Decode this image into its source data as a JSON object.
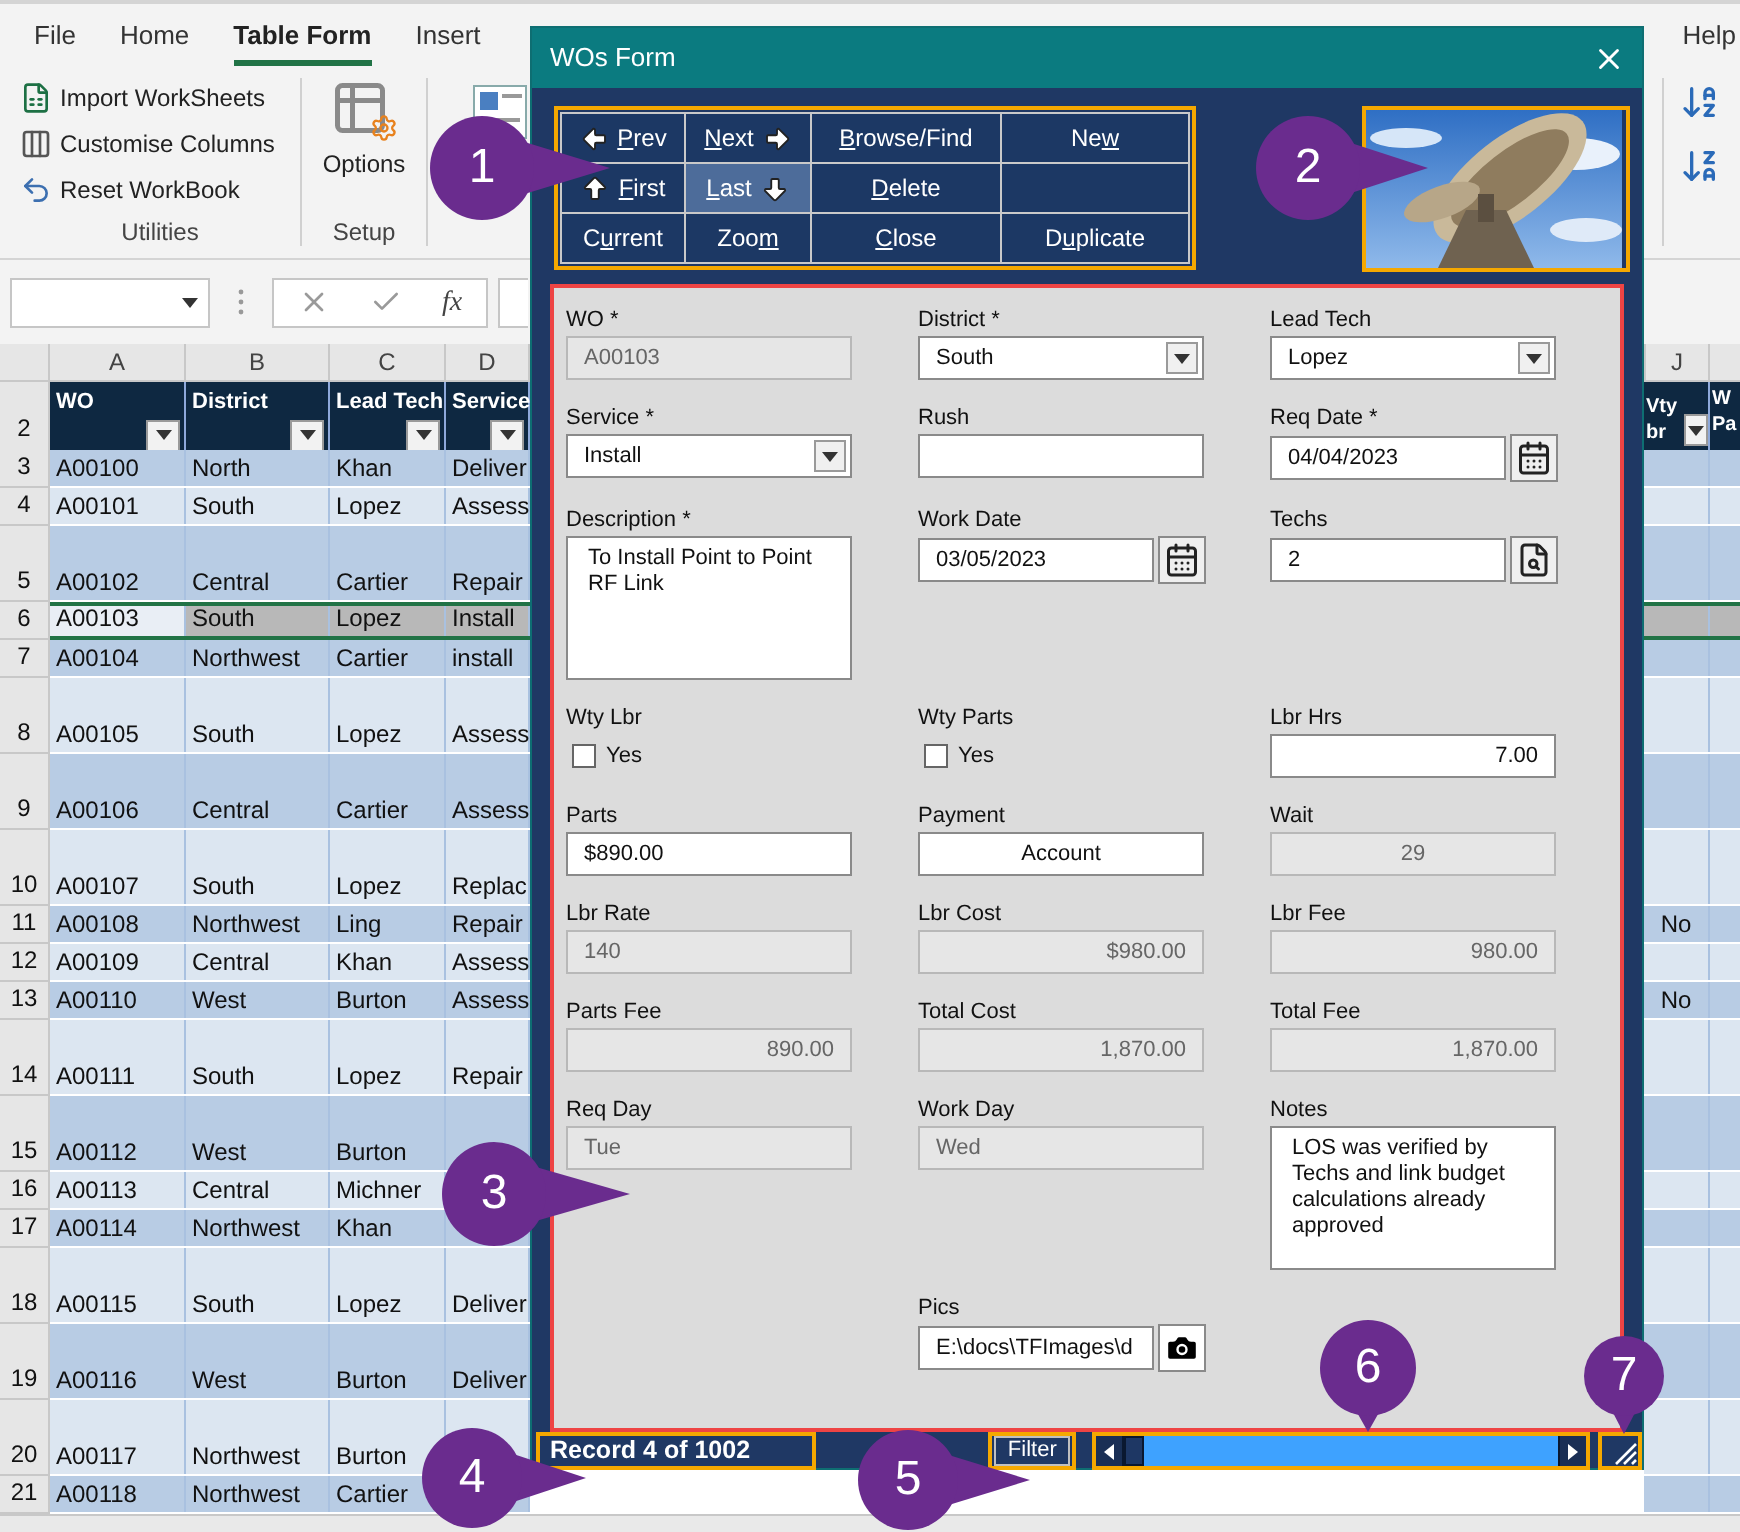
{
  "ribbon": {
    "tabs": [
      {
        "label": "File",
        "selected": false
      },
      {
        "label": "Home",
        "selected": false
      },
      {
        "label": "Table Form",
        "selected": true
      },
      {
        "label": "Insert",
        "selected": false
      }
    ],
    "help_tab": {
      "label": "Help",
      "selected": false
    },
    "utilities": {
      "title": "Utilities",
      "items": [
        "Import WorkSheets",
        "Customise Columns",
        "Reset WorkBook"
      ]
    },
    "setup": {
      "title": "Setup",
      "button": "Options"
    }
  },
  "formula_bar": {
    "function_label": "fx"
  },
  "sheet": {
    "columns": [
      {
        "letter": "A",
        "header": "WO"
      },
      {
        "letter": "B",
        "header": "District"
      },
      {
        "letter": "C",
        "header": "Lead Tech"
      },
      {
        "letter": "D",
        "header": "Service"
      }
    ],
    "column_j": {
      "letter": "J",
      "header": "Vty br"
    },
    "column_k": {
      "header": "W Pa"
    },
    "header_row": "2",
    "rows": [
      {
        "number": "3",
        "cells": [
          "A00100",
          "North",
          "Khan",
          "Deliver"
        ],
        "tall": false,
        "selected": false
      },
      {
        "number": "4",
        "cells": [
          "A00101",
          "South",
          "Lopez",
          "Assess"
        ],
        "tall": false,
        "selected": false
      },
      {
        "number": "5",
        "cells": [
          "A00102",
          "Central",
          "Cartier",
          "Repair"
        ],
        "tall": true,
        "selected": false
      },
      {
        "number": "6",
        "cells": [
          "A00103",
          "South",
          "Lopez",
          "Install"
        ],
        "tall": false,
        "selected": true
      },
      {
        "number": "7",
        "cells": [
          "A00104",
          "Northwest",
          "Cartier",
          "install"
        ],
        "tall": false,
        "selected": false
      },
      {
        "number": "8",
        "cells": [
          "A00105",
          "South",
          "Lopez",
          "Assess"
        ],
        "tall": true,
        "selected": false
      },
      {
        "number": "9",
        "cells": [
          "A00106",
          "Central",
          "Cartier",
          "Assess"
        ],
        "tall": true,
        "selected": false
      },
      {
        "number": "10",
        "cells": [
          "A00107",
          "South",
          "Lopez",
          "Replac"
        ],
        "tall": true,
        "selected": false
      },
      {
        "number": "11",
        "cells": [
          "A00108",
          "Northwest",
          "Ling",
          "Repair"
        ],
        "tall": false,
        "selected": false,
        "j": "No"
      },
      {
        "number": "12",
        "cells": [
          "A00109",
          "Central",
          "Khan",
          "Assess"
        ],
        "tall": false,
        "selected": false
      },
      {
        "number": "13",
        "cells": [
          "A00110",
          "West",
          "Burton",
          "Assess"
        ],
        "tall": false,
        "selected": false,
        "j": "No"
      },
      {
        "number": "14",
        "cells": [
          "A00111",
          "South",
          "Lopez",
          "Repair"
        ],
        "tall": true,
        "selected": false
      },
      {
        "number": "15",
        "cells": [
          "A00112",
          "West",
          "Burton"
        ],
        "tall": true,
        "selected": false
      },
      {
        "number": "16",
        "cells": [
          "A00113",
          "Central",
          "Michner"
        ],
        "tall": false,
        "selected": false
      },
      {
        "number": "17",
        "cells": [
          "A00114",
          "Northwest",
          "Khan"
        ],
        "tall": false,
        "selected": false
      },
      {
        "number": "18",
        "cells": [
          "A00115",
          "South",
          "Lopez",
          "Deliver"
        ],
        "tall": true,
        "selected": false
      },
      {
        "number": "19",
        "cells": [
          "A00116",
          "West",
          "Burton",
          "Deliver"
        ],
        "tall": true,
        "selected": false
      },
      {
        "number": "20",
        "cells": [
          "A00117",
          "Northwest",
          "Burton"
        ],
        "tall": true,
        "selected": false
      },
      {
        "number": "21",
        "cells": [
          "A00118",
          "Northwest",
          "Cartier"
        ],
        "tall": false,
        "selected": false
      }
    ]
  },
  "form": {
    "title": "WOs Form",
    "nav_buttons": [
      {
        "key": "P",
        "after": "rev",
        "focused": false
      },
      {
        "key": "N",
        "after": "ext",
        "focused": false
      },
      {
        "key": "B",
        "after": "rowse/Find",
        "focused": false
      },
      {
        "before": "Ne",
        "key": "w",
        "focused": false
      },
      {
        "key": "F",
        "after": "irst",
        "focused": false
      },
      {
        "key": "L",
        "after": "ast",
        "focused": true
      },
      {
        "key": "D",
        "after": "elete",
        "focused": false
      },
      {
        "focused": false
      },
      {
        "before": "C",
        "key": "u",
        "after": "rrent",
        "focused": false
      },
      {
        "before": "Zoo",
        "key": "m",
        "focused": false
      },
      {
        "key": "C",
        "after": "lose",
        "focused": false
      },
      {
        "before": "D",
        "key": "u",
        "after": "plicate",
        "focused": false
      }
    ],
    "fields": [
      {
        "label": "WO *",
        "kind": "text",
        "value": "A00103",
        "disabled": true
      },
      {
        "label": "District *",
        "kind": "dropdown",
        "value": "South",
        "disabled": false
      },
      {
        "label": "Lead Tech",
        "kind": "dropdown",
        "value": "Lopez",
        "disabled": false
      },
      {
        "label": "Service *",
        "kind": "dropdown",
        "value": "Install",
        "disabled": false
      },
      {
        "label": "Rush",
        "kind": "text",
        "disabled": false
      },
      {
        "label": "Req Date *",
        "kind": "date",
        "value": "04/04/2023",
        "disabled": false
      },
      {
        "label": "Description *",
        "kind": "memo",
        "value": "To Install Point to Point RF Link",
        "disabled": false
      },
      {
        "label": "Work Date",
        "kind": "date",
        "value": "03/05/2023",
        "disabled": false
      },
      {
        "label": "Techs",
        "kind": "lookup",
        "value": "2",
        "disabled": false
      },
      {
        "label": "Wty Lbr",
        "kind": "check",
        "option": "Yes",
        "checked": false,
        "disabled": false
      },
      {
        "label": "Wty Parts",
        "kind": "check",
        "option": "Yes",
        "checked": false,
        "disabled": false
      },
      {
        "label": "Lbr Hrs",
        "kind": "amount",
        "value": "7.00",
        "disabled": false
      },
      {
        "label": "Parts",
        "kind": "text",
        "value": "$890.00",
        "disabled": false
      },
      {
        "label": "Payment",
        "kind": "list",
        "value": "Account",
        "disabled": false
      },
      {
        "label": "Wait",
        "kind": "count",
        "value": "29",
        "disabled": true
      },
      {
        "label": "Lbr Rate",
        "kind": "text",
        "value": "140",
        "disabled": true
      },
      {
        "label": "Lbr Cost",
        "kind": "amount",
        "value": "$980.00",
        "disabled": true
      },
      {
        "label": "Lbr Fee",
        "kind": "amount",
        "value": "980.00",
        "disabled": true
      },
      {
        "label": "Parts Fee",
        "kind": "amount",
        "value": "890.00",
        "disabled": true
      },
      {
        "label": "Total Cost",
        "kind": "amount",
        "value": "1,870.00",
        "disabled": true
      },
      {
        "label": "Total Fee",
        "kind": "amount",
        "value": "1,870.00",
        "disabled": true
      },
      {
        "label": "Req Day",
        "kind": "text",
        "value": "Tue",
        "disabled": true
      },
      {
        "label": "Work Day",
        "kind": "text",
        "value": "Wed",
        "disabled": true
      },
      {
        "label": "Notes",
        "kind": "memo",
        "value": "LOS was verified by Techs and link budget calculations already approved",
        "disabled": false
      }
    ],
    "pics": {
      "label": "Pics",
      "value": "E:\\docs\\TFImages\\d",
      "disabled": false
    },
    "status": {
      "record": "Record 4 of 1002",
      "filter": "Filter"
    }
  },
  "callouts": [
    "1",
    "2",
    "3",
    "4",
    "5",
    "6",
    "7"
  ]
}
